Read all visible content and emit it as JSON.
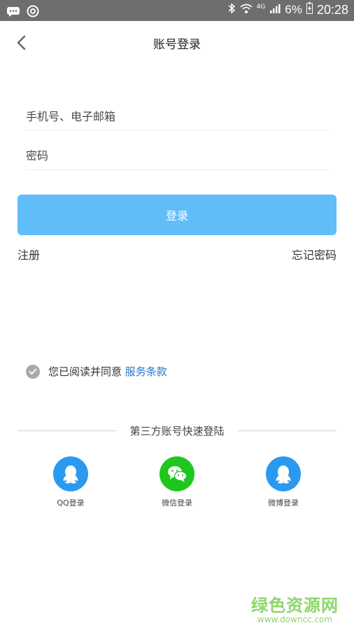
{
  "status_bar": {
    "network": "4G",
    "battery": "6%",
    "time": "20:28"
  },
  "header": {
    "title": "账号登录"
  },
  "form": {
    "phone_placeholder": "手机号、电子邮箱",
    "password_placeholder": "密码",
    "login_label": "登录",
    "register_label": "注册",
    "forgot_label": "忘记密码"
  },
  "agreement": {
    "text": "您已阅读并同意",
    "terms_link": "服务条款"
  },
  "third_party": {
    "title": "第三方账号快速登陆",
    "items": [
      {
        "label": "QQ登录",
        "icon": "qq-icon",
        "color": "#2a9af0"
      },
      {
        "label": "微信登录",
        "icon": "wechat-icon",
        "color": "#1ec61e"
      },
      {
        "label": "微博登录",
        "icon": "weibo-icon",
        "color": "#2a9af0"
      }
    ]
  },
  "watermark": {
    "main": "绿色资源网",
    "sub": "www.downcc.com"
  },
  "colors": {
    "primary_button": "#60bdf8",
    "link": "#2476c6",
    "status_bar": "#6e6e6e"
  }
}
